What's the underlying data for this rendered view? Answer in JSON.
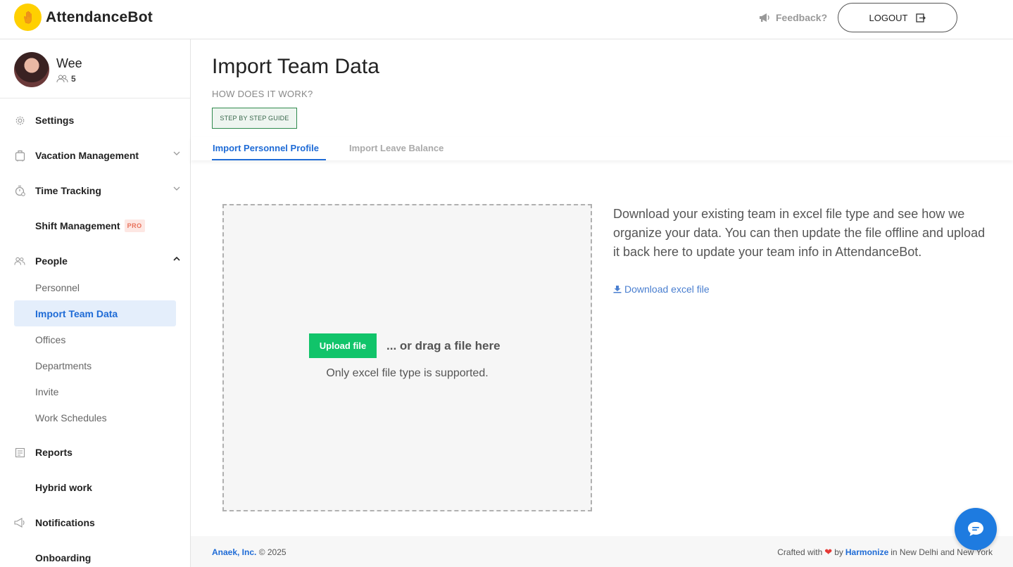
{
  "header": {
    "brand": "AttendanceBot",
    "feedback_label": "Feedback?",
    "logout_label": "LOGOUT"
  },
  "profile": {
    "name": "Wee",
    "member_count": "5"
  },
  "sidebar": {
    "items": [
      {
        "label": "Settings",
        "icon": "gear-icon"
      },
      {
        "label": "Vacation Management",
        "icon": "suitcase-icon"
      },
      {
        "label": "Time Tracking",
        "icon": "stopwatch-icon"
      },
      {
        "label": "Shift Management",
        "badge": "PRO"
      },
      {
        "label": "People",
        "icon": "people-icon"
      },
      {
        "label": "Reports",
        "icon": "report-icon"
      },
      {
        "label": "Hybrid work"
      },
      {
        "label": "Notifications",
        "icon": "megaphone-icon"
      },
      {
        "label": "Onboarding"
      }
    ],
    "people_sub": [
      {
        "label": "Personnel"
      },
      {
        "label": "Import Team Data"
      },
      {
        "label": "Offices"
      },
      {
        "label": "Departments"
      },
      {
        "label": "Invite"
      },
      {
        "label": "Work Schedules"
      }
    ]
  },
  "main": {
    "title": "Import Team Data",
    "how_label": "HOW DOES IT WORK?",
    "guide_button": "STEP BY STEP GUIDE",
    "tabs": [
      {
        "label": "Import Personnel Profile",
        "active": true
      },
      {
        "label": "Import Leave Balance",
        "active": false
      }
    ],
    "dropzone": {
      "upload_button": "Upload file",
      "drag_text": "... or drag a file here",
      "support_text": "Only excel file type is supported."
    },
    "description": "Download your existing team in excel file type and see how we organize your data. You can then update the file offline and upload it back here to update your team info in AttendanceBot.",
    "download_link": "Download excel file"
  },
  "footer": {
    "company": "Anaek, Inc.",
    "copyright": "© 2025",
    "crafted_prefix": "Crafted with",
    "crafted_by": "by",
    "maker": "Harmonize",
    "crafted_suffix": "in New Delhi and New York"
  },
  "colors": {
    "accent": "#1e6bd6",
    "upload_green": "#11c46a",
    "brand_yellow": "#ffd000",
    "pro_badge": "#e8705a"
  }
}
